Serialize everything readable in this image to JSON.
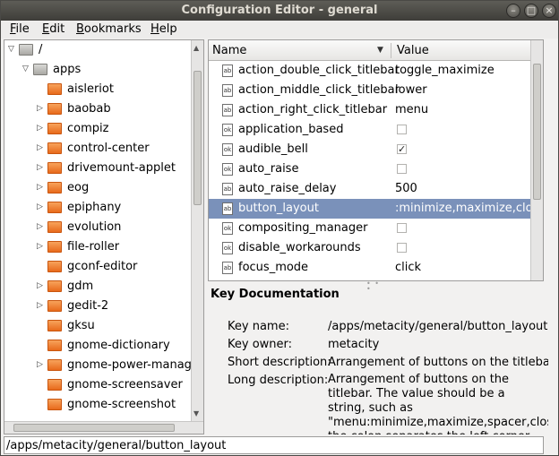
{
  "window": {
    "title": "Configuration Editor - general"
  },
  "menubar": {
    "items": [
      {
        "label": "File",
        "mnemonic": "F"
      },
      {
        "label": "Edit",
        "mnemonic": "E"
      },
      {
        "label": "Bookmarks",
        "mnemonic": "B"
      },
      {
        "label": "Help",
        "mnemonic": "H"
      }
    ]
  },
  "tree": {
    "items": [
      {
        "label": "/",
        "expander": "down",
        "folder": "gray",
        "level": 0
      },
      {
        "label": "apps",
        "expander": "down",
        "folder": "gray",
        "level": 1
      },
      {
        "label": "aisleriot",
        "expander": "none",
        "folder": "orange",
        "level": 2
      },
      {
        "label": "baobab",
        "expander": "right",
        "folder": "orange",
        "level": 2
      },
      {
        "label": "compiz",
        "expander": "right",
        "folder": "orange",
        "level": 2
      },
      {
        "label": "control-center",
        "expander": "right",
        "folder": "orange",
        "level": 2
      },
      {
        "label": "drivemount-applet",
        "expander": "right",
        "folder": "orange",
        "level": 2
      },
      {
        "label": "eog",
        "expander": "right",
        "folder": "orange",
        "level": 2
      },
      {
        "label": "epiphany",
        "expander": "right",
        "folder": "orange",
        "level": 2
      },
      {
        "label": "evolution",
        "expander": "right",
        "folder": "orange",
        "level": 2
      },
      {
        "label": "file-roller",
        "expander": "right",
        "folder": "orange",
        "level": 2
      },
      {
        "label": "gconf-editor",
        "expander": "none",
        "folder": "orange",
        "level": 2
      },
      {
        "label": "gdm",
        "expander": "right",
        "folder": "orange",
        "level": 2
      },
      {
        "label": "gedit-2",
        "expander": "right",
        "folder": "orange",
        "level": 2
      },
      {
        "label": "gksu",
        "expander": "none",
        "folder": "orange",
        "level": 2
      },
      {
        "label": "gnome-dictionary",
        "expander": "none",
        "folder": "orange",
        "level": 2
      },
      {
        "label": "gnome-power-manager",
        "expander": "right",
        "folder": "orange",
        "level": 2
      },
      {
        "label": "gnome-screensaver",
        "expander": "none",
        "folder": "orange",
        "level": 2
      },
      {
        "label": "gnome-screenshot",
        "expander": "none",
        "folder": "orange",
        "level": 2
      }
    ]
  },
  "table": {
    "columns": {
      "name": "Name",
      "value": "Value"
    },
    "rows": [
      {
        "name": "action_double_click_titlebar",
        "type": "string",
        "value": "toggle_maximize"
      },
      {
        "name": "action_middle_click_titlebar",
        "type": "string",
        "value": "lower"
      },
      {
        "name": "action_right_click_titlebar",
        "type": "string",
        "value": "menu"
      },
      {
        "name": "application_based",
        "type": "bool",
        "checked": false
      },
      {
        "name": "audible_bell",
        "type": "bool",
        "checked": true
      },
      {
        "name": "auto_raise",
        "type": "bool",
        "checked": false
      },
      {
        "name": "auto_raise_delay",
        "type": "int",
        "value": "500"
      },
      {
        "name": "button_layout",
        "type": "string",
        "value": ":minimize,maximize,close",
        "selected": true
      },
      {
        "name": "compositing_manager",
        "type": "bool",
        "checked": false
      },
      {
        "name": "disable_workarounds",
        "type": "bool",
        "checked": false
      },
      {
        "name": "focus_mode",
        "type": "string",
        "value": "click"
      }
    ]
  },
  "doc": {
    "title": "Key Documentation",
    "key_name_label": "Key name:",
    "key_name": "/apps/metacity/general/button_layout",
    "key_owner_label": "Key owner:",
    "key_owner": "metacity",
    "short_desc_label": "Short description:",
    "short_desc": "Arrangement of buttons on the titlebar",
    "long_desc_label": "Long description:",
    "long_desc": "Arrangement of buttons on the titlebar. The value should be a string, such as \"menu:minimize,maximize,spacer,close\" the colon separates the left corner of"
  },
  "statusbar": {
    "path": "/apps/metacity/general/button_layout"
  },
  "colors": {
    "selection": "#7a91ba",
    "folder_orange": "#f07a2a",
    "titlebar": "#3e3d39"
  }
}
